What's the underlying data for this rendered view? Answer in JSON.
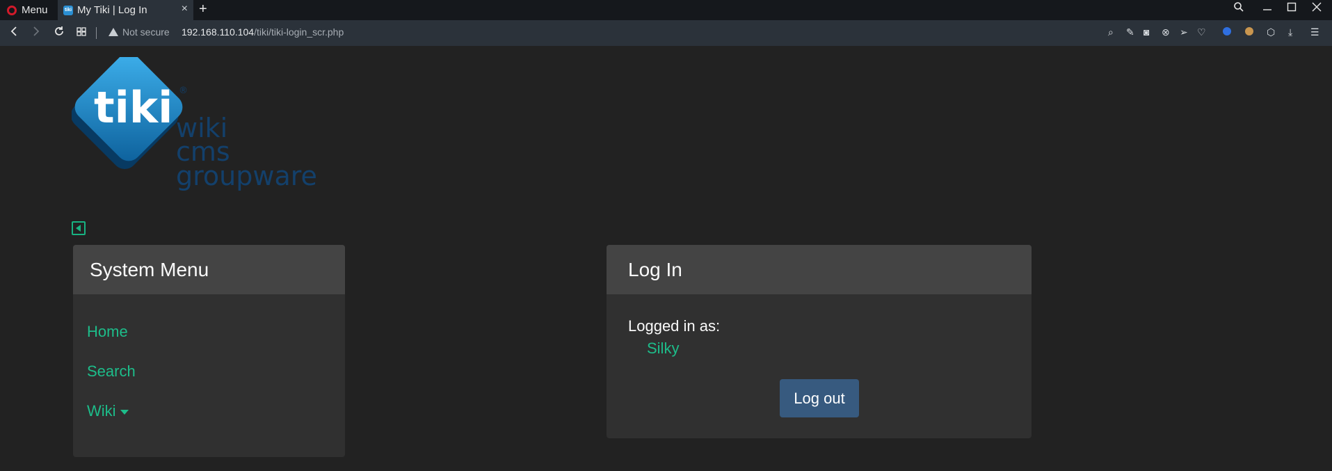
{
  "browser": {
    "menu_label": "Menu",
    "tab_title": "My Tiki | Log In",
    "tab_favicon_text": "tiki",
    "security_label": "Not secure",
    "url_host": "192.168.110.104",
    "url_path": "/tiki/tiki-login_scr.php",
    "icons": {
      "nav": [
        "back-icon",
        "forward-icon",
        "reload-icon",
        "tabs-grid-icon"
      ],
      "tools": [
        "zoom-icon",
        "edit-icon",
        "camera-icon",
        "block-icon",
        "send-icon",
        "heart-icon",
        "extension-icon",
        "cookie-icon",
        "cube-icon",
        "download-icon",
        "settings-icon"
      ]
    }
  },
  "logo": {
    "mark": "tiki",
    "registered": "®",
    "lines": [
      "wiki",
      "cms",
      "groupware"
    ],
    "colors": {
      "mark": "#1a8fd0",
      "text": "#13406b"
    }
  },
  "system_menu": {
    "title": "System Menu",
    "items": [
      {
        "label": "Home"
      },
      {
        "label": "Search"
      },
      {
        "label": "Wiki"
      }
    ]
  },
  "login_box": {
    "title": "Log In",
    "logged_in_label": "Logged in as:",
    "username": "Silky",
    "logout_label": "Log out"
  },
  "colors": {
    "page_bg": "#222222",
    "link": "#1dbd8a",
    "card_header": "#444444",
    "card_body": "#303030",
    "button": "#375a7f"
  }
}
